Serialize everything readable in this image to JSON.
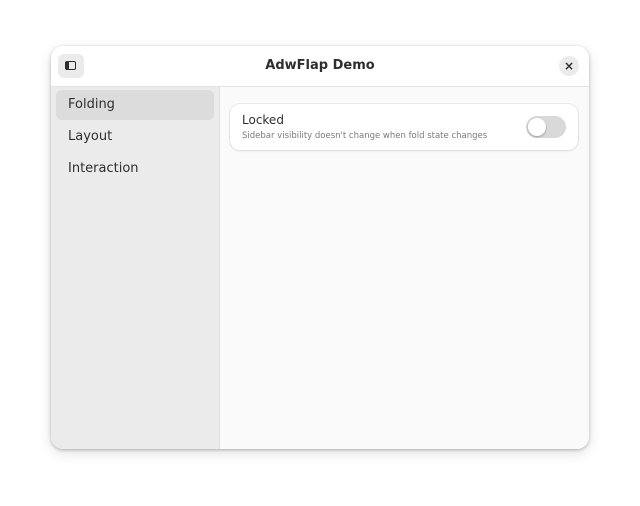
{
  "window": {
    "title": "AdwFlap Demo",
    "close_label": "×"
  },
  "sidebar": {
    "items": [
      {
        "label": "Folding",
        "selected": true
      },
      {
        "label": "Layout",
        "selected": false
      },
      {
        "label": "Interaction",
        "selected": false
      }
    ]
  },
  "content": {
    "row": {
      "title": "Locked",
      "subtitle": "Sidebar visibility doesn't change when fold state changes",
      "switch_on": false
    }
  },
  "icons": {
    "sidebar_toggle": "sidebar-show-icon",
    "close": "window-close-icon"
  }
}
